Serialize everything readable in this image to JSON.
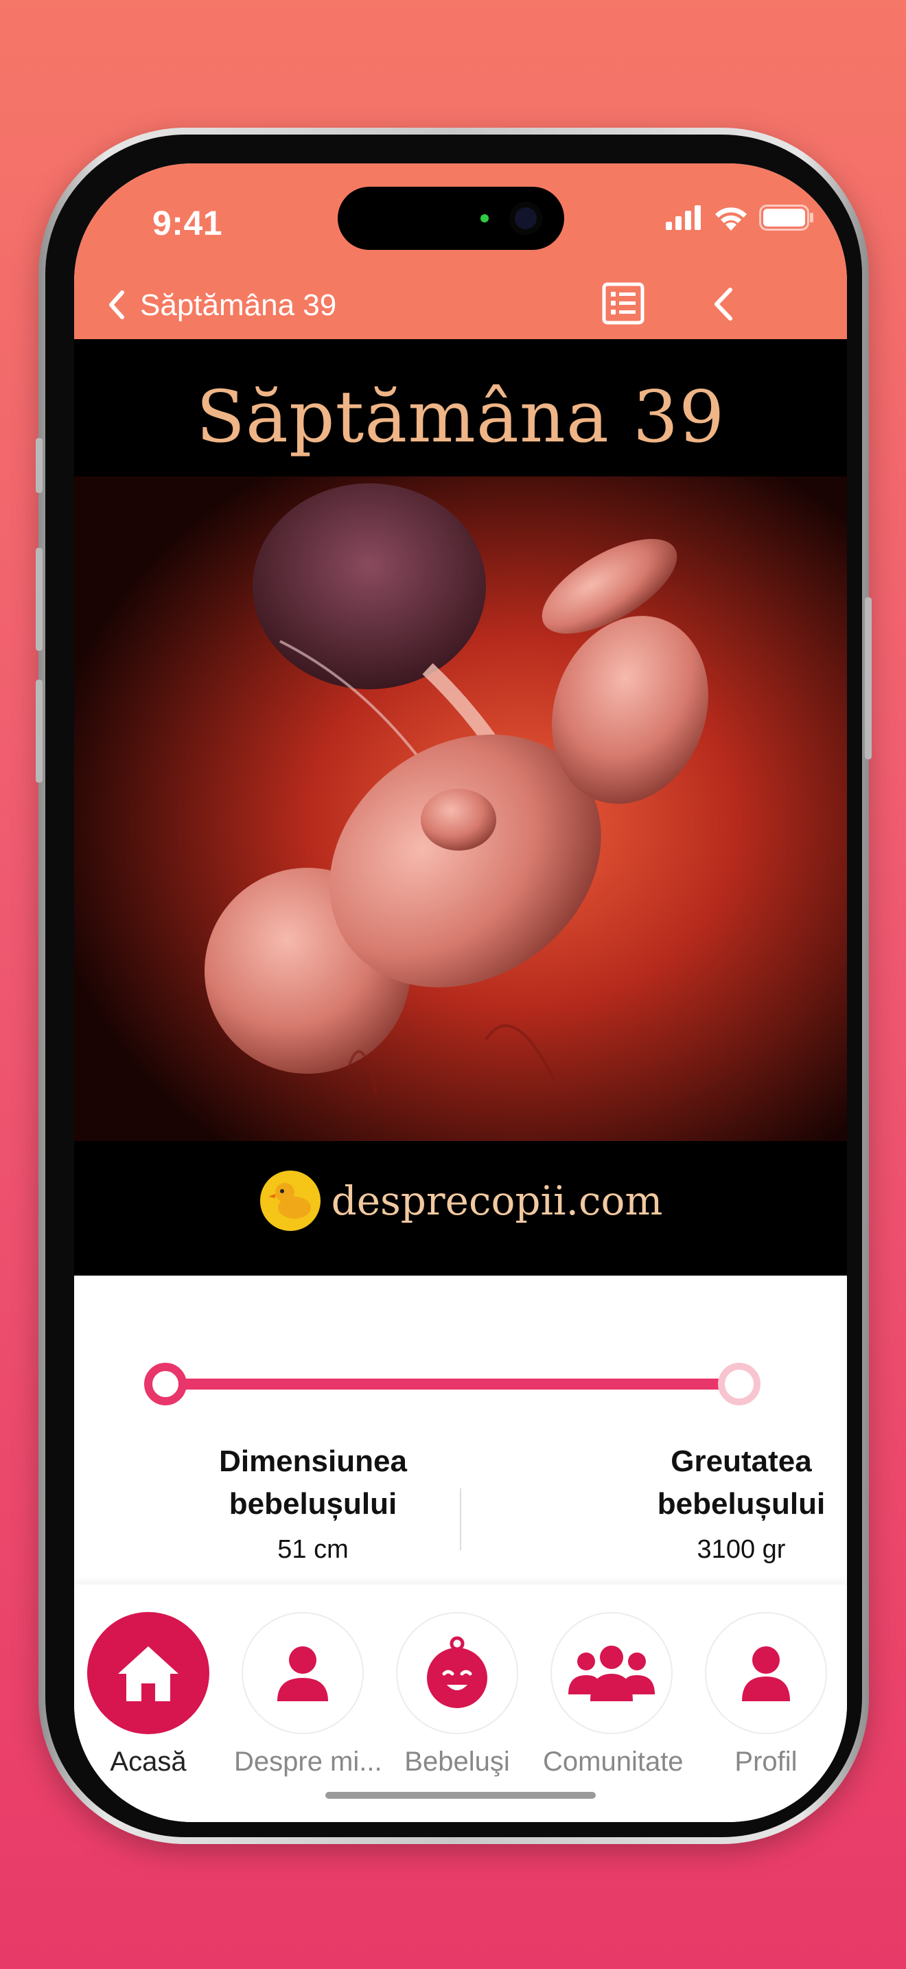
{
  "status_bar": {
    "time": "9:41"
  },
  "nav": {
    "title": "Săptămâna 39"
  },
  "hero": {
    "title": "Săptămâna 39",
    "brand": "desprecopii.com"
  },
  "info": {
    "size_label_line1": "Dimensiunea",
    "size_label_line2": "bebelușului",
    "size_value": "51 cm",
    "weight_label_line1": "Greutatea",
    "weight_label_line2": "bebelușului",
    "weight_value": "3100 gr",
    "progress_fraction": 0.975
  },
  "tabs": [
    {
      "label": "Acasă",
      "icon": "home-icon",
      "active": true
    },
    {
      "label": "Despre mi...",
      "icon": "person-icon",
      "active": false
    },
    {
      "label": "Bebeluşi",
      "icon": "baby-face-icon",
      "active": false
    },
    {
      "label": "Comunitate",
      "icon": "group-icon",
      "active": false
    },
    {
      "label": "Profil",
      "icon": "profile-icon",
      "active": false
    }
  ],
  "colors": {
    "header": "#f57a62",
    "accent": "#d7154e",
    "slider": "#e8356a"
  }
}
